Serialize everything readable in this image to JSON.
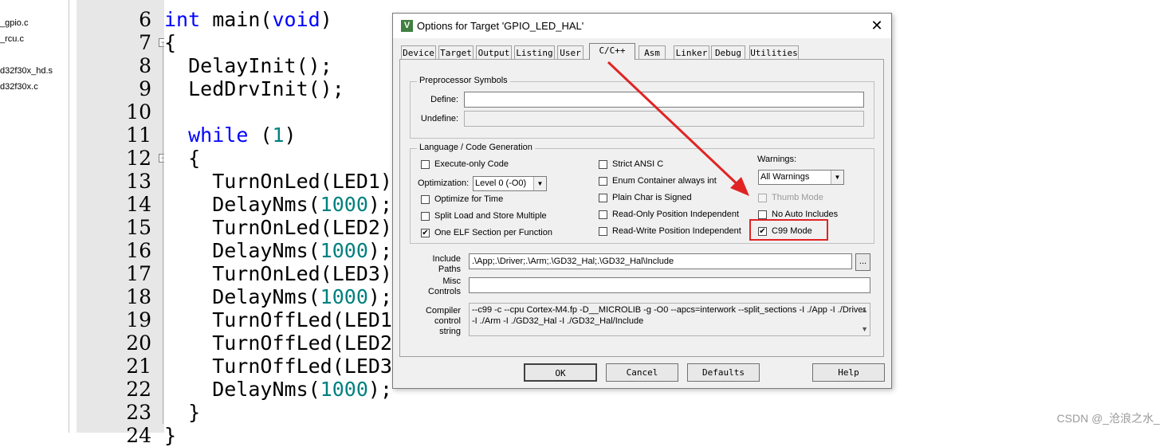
{
  "file_tree": {
    "files": [
      "_gpio.c",
      "_rcu.c",
      "d32f30x_hd.s",
      "d32f30x.c"
    ]
  },
  "editor": {
    "lines": [
      {
        "no": "6",
        "code": [
          {
            "t": "int",
            "c": "kw"
          },
          {
            "t": " main("
          },
          {
            "t": "void",
            "c": "kw"
          },
          {
            "t": ")"
          }
        ]
      },
      {
        "no": "7",
        "code": [
          {
            "t": "{"
          }
        ]
      },
      {
        "no": "8",
        "code": [
          {
            "t": "  DelayInit();"
          }
        ]
      },
      {
        "no": "9",
        "code": [
          {
            "t": "  LedDrvInit();"
          }
        ]
      },
      {
        "no": "10",
        "code": []
      },
      {
        "no": "11",
        "code": [
          {
            "t": "  "
          },
          {
            "t": "while",
            "c": "kw"
          },
          {
            "t": " ("
          },
          {
            "t": "1",
            "c": "num"
          },
          {
            "t": ")"
          }
        ]
      },
      {
        "no": "12",
        "code": [
          {
            "t": "  {"
          }
        ]
      },
      {
        "no": "13",
        "code": [
          {
            "t": "    TurnOnLed(LED1)"
          }
        ]
      },
      {
        "no": "14",
        "code": [
          {
            "t": "    DelayNms("
          },
          {
            "t": "1000",
            "c": "num"
          },
          {
            "t": ");"
          }
        ]
      },
      {
        "no": "15",
        "code": [
          {
            "t": "    TurnOnLed(LED2)"
          }
        ]
      },
      {
        "no": "16",
        "code": [
          {
            "t": "    DelayNms("
          },
          {
            "t": "1000",
            "c": "num"
          },
          {
            "t": ");"
          }
        ]
      },
      {
        "no": "17",
        "code": [
          {
            "t": "    TurnOnLed(LED3)"
          }
        ]
      },
      {
        "no": "18",
        "code": [
          {
            "t": "    DelayNms("
          },
          {
            "t": "1000",
            "c": "num"
          },
          {
            "t": ");"
          }
        ]
      },
      {
        "no": "19",
        "code": [
          {
            "t": "    TurnOffLed(LED1"
          }
        ]
      },
      {
        "no": "20",
        "code": [
          {
            "t": "    TurnOffLed(LED2"
          }
        ]
      },
      {
        "no": "21",
        "code": [
          {
            "t": "    TurnOffLed(LED3"
          }
        ]
      },
      {
        "no": "22",
        "code": [
          {
            "t": "    DelayNms("
          },
          {
            "t": "1000",
            "c": "num"
          },
          {
            "t": ");"
          }
        ]
      },
      {
        "no": "23",
        "code": [
          {
            "t": "  }"
          }
        ]
      },
      {
        "no": "24",
        "code": [
          {
            "t": "}"
          }
        ]
      }
    ]
  },
  "dialog": {
    "title": "Options for Target 'GPIO_LED_HAL'",
    "close": "✕",
    "icon": "keil-uvision-icon",
    "tabs": [
      "Device",
      "Target",
      "Output",
      "Listing",
      "User",
      "C/C++",
      "Asm",
      "Linker",
      "Debug",
      "Utilities"
    ],
    "active_tab": "C/C++",
    "preprocessor": {
      "title": "Preprocessor Symbols",
      "define_label": "Define:",
      "define_value": "",
      "undefine_label": "Undefine:",
      "undefine_value": ""
    },
    "language": {
      "title": "Language / Code Generation",
      "execute_only": {
        "label": "Execute-only Code",
        "checked": false
      },
      "optimization_label": "Optimization:",
      "optimization_value": "Level 0 (-O0)",
      "optimize_time": {
        "label": "Optimize for Time",
        "checked": false
      },
      "split_load": {
        "label": "Split Load and Store Multiple",
        "checked": false
      },
      "one_elf": {
        "label": "One ELF Section per Function",
        "checked": true
      },
      "strict_ansi": {
        "label": "Strict ANSI C",
        "checked": false
      },
      "enum_container": {
        "label": "Enum Container always int",
        "checked": false
      },
      "plain_char": {
        "label": "Plain Char is Signed",
        "checked": false
      },
      "ropi": {
        "label": "Read-Only Position Independent",
        "checked": false
      },
      "rwpi": {
        "label": "Read-Write Position Independent",
        "checked": false
      },
      "warnings_label": "Warnings:",
      "warnings_value": "All Warnings",
      "thumb_mode": {
        "label": "Thumb Mode",
        "checked": false,
        "disabled": true
      },
      "no_auto_includes": {
        "label": "No Auto Includes",
        "checked": false
      },
      "c99_mode": {
        "label": "C99 Mode",
        "checked": true
      }
    },
    "include_paths_label_1": "Include",
    "include_paths_label_2": "Paths",
    "include_paths_value": ".\\App;.\\Driver;.\\Arm;.\\GD32_Hal;.\\GD32_Hal\\Include",
    "browse_label": "...",
    "misc_label_1": "Misc",
    "misc_label_2": "Controls",
    "misc_value": "",
    "compiler_label_1": "Compiler",
    "compiler_label_2": "control",
    "compiler_label_3": "string",
    "compiler_line_1": "--c99 -c --cpu Cortex-M4.fp -D__MICROLIB -g -O0 --apcs=interwork --split_sections -I ./App -I ./Driver",
    "compiler_line_2": "-I ./Arm -I ./GD32_Hal -I ./GD32_Hal/Include",
    "buttons": {
      "ok": "OK",
      "cancel": "Cancel",
      "defaults": "Defaults",
      "help": "Help"
    }
  },
  "annotation": {
    "arrow_color": "#e02424"
  },
  "watermark": "CSDN @_沧浪之水_"
}
